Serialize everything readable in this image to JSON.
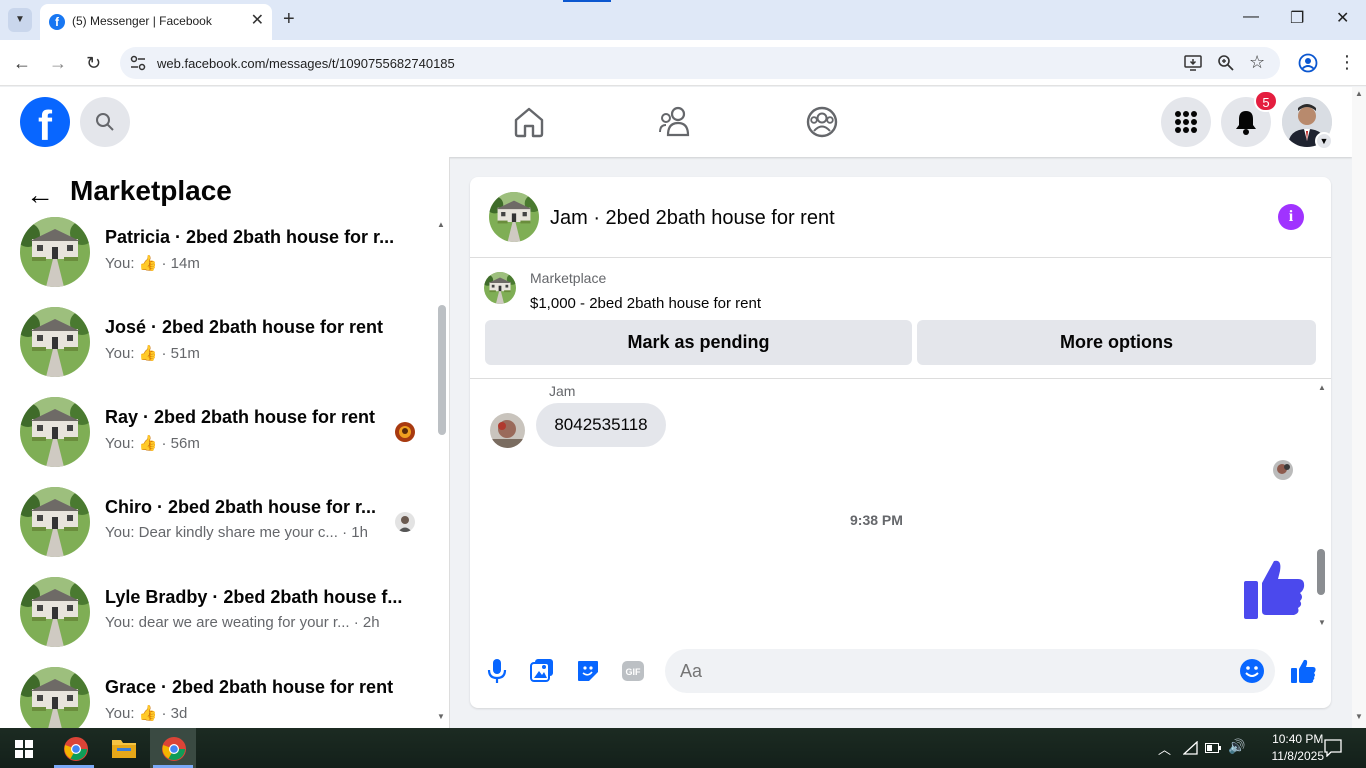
{
  "browser": {
    "tab_title": "(5) Messenger | Facebook",
    "url": "web.facebook.com/messages/t/1090755682740185"
  },
  "header": {
    "notification_count": "5"
  },
  "marketplace_panel": {
    "title": "Marketplace",
    "conversations": [
      {
        "name": "Patricia · 2bed 2bath house for r...",
        "preview": "You: ",
        "like": true,
        "time": "· 14m"
      },
      {
        "name": "José · 2bed 2bath house for rent",
        "preview": "You: ",
        "like": true,
        "time": "· 51m"
      },
      {
        "name": "Ray · 2bed 2bath house for rent",
        "preview": "You: ",
        "like": true,
        "time": "· 56m"
      },
      {
        "name": "Chiro · 2bed 2bath house for r...",
        "preview": "You: Dear kindly share me your c...",
        "like": false,
        "time": "· 1h"
      },
      {
        "name": "Lyle Bradby · 2bed 2bath house f...",
        "preview": "You: dear we are weating for your r...",
        "like": false,
        "time": "· 2h"
      },
      {
        "name": "Grace · 2bed 2bath house for rent",
        "preview": "You: ",
        "like": true,
        "time": "· 3d"
      }
    ]
  },
  "chat": {
    "title": "Jam · 2bed 2bath house for rent",
    "listing_label": "Marketplace",
    "listing_item": "$1,000 - 2bed 2bath house for rent",
    "mark_pending_label": "Mark as pending",
    "more_options_label": "More options",
    "sender_name": "Jam",
    "message_text": "8042535118",
    "timestamp": "9:38 PM",
    "composer_placeholder": "Aa"
  },
  "taskbar": {
    "time": "10:40 PM",
    "date": "11/8/2025"
  },
  "colors": {
    "facebook_blue": "#0866ff",
    "like_blue": "#0866ff",
    "info_purple": "#a033ff",
    "badge_red": "#e41e3f"
  }
}
